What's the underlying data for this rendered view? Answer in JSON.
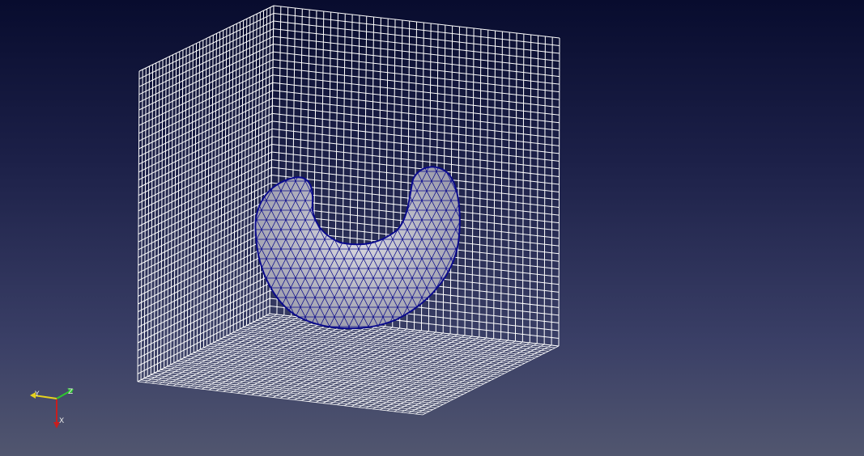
{
  "viewport": {
    "background_top": "#080c2e",
    "background_bottom": "#51566f",
    "grid_color": "#ffffff",
    "grid_divisions": 40
  },
  "mesh": {
    "fill_color": "#c8c8d2",
    "edge_color": "#0a0a8c"
  },
  "orientation_axes": {
    "x_label": "X",
    "y_label": "Y",
    "z_label": "Z",
    "x_color": "#c81e1e",
    "y_color": "#e6d21e",
    "z_color": "#2ec82e"
  }
}
